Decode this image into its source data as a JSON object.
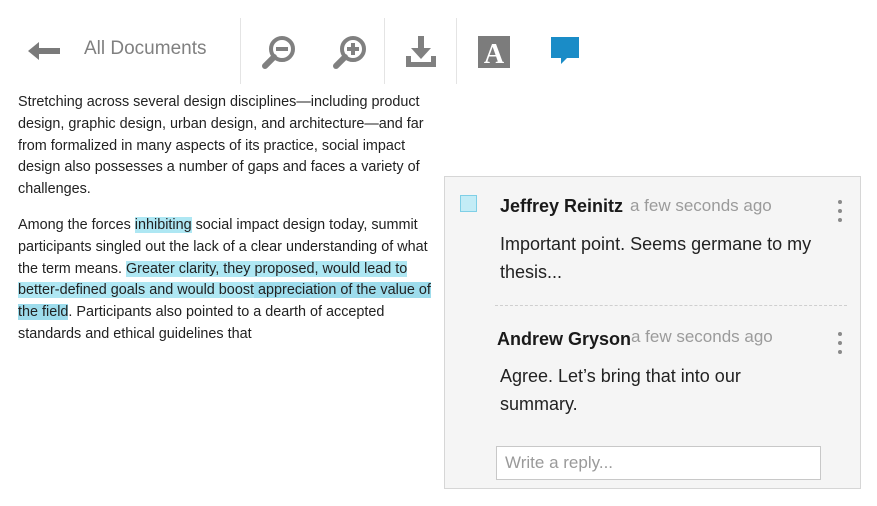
{
  "toolbar": {
    "back_label": "All Documents",
    "icons": [
      "back-arrow-icon",
      "zoom-out-icon",
      "zoom-in-icon",
      "download-icon",
      "font-icon",
      "comment-icon"
    ],
    "accent_color": "#1a8cc7"
  },
  "document": {
    "p1": "Stretching across several design disciplines—including product design, graphic design, urban design, and architecture—and far from formalized in many aspects of its practice, social impact design also possesses a number of gaps and faces a variety of challenges.",
    "p2_a": "Among the forces ",
    "p2_hl1": "inhibiting",
    "p2_b": " social impact design today, summit participants singled out the lack of a clear understanding of what the term means. ",
    "p2_hl2a": "Greater clarity, they proposed, would lead to better-defined goals and would boost",
    "p2_hl2b": " appre­ciation of the value of the field",
    "p2_c": ". Participants also pointed to a dearth of accepted standards and ethical guidelines that",
    "highlight_color": "#aee7f3"
  },
  "comments": {
    "items": [
      {
        "author": "Jeffrey Reinitz",
        "time": "a few seconds ago",
        "text": "Important point. Seems germane to my thesis..."
      },
      {
        "author": "Andrew Gryson",
        "time": "a few seconds ago",
        "text": "Agree. Let’s bring that into our summary."
      }
    ],
    "reply_placeholder": "Write a reply..."
  }
}
